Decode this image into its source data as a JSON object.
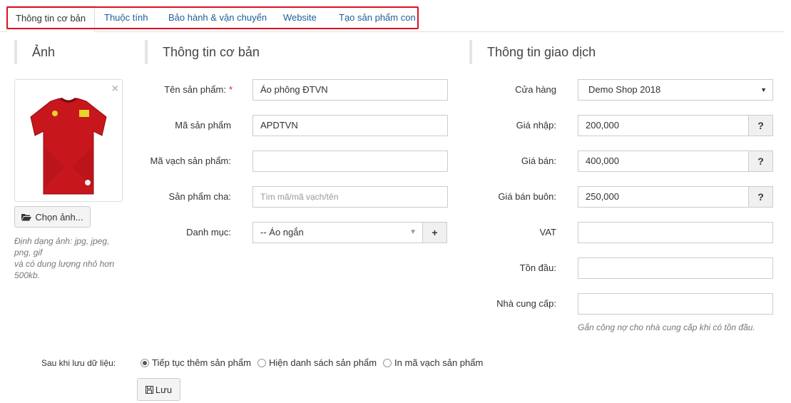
{
  "tabs": [
    {
      "label": "Thông tin cơ bản"
    },
    {
      "label": "Thuộc tính"
    },
    {
      "label": "Bảo hành & vận chuyển"
    },
    {
      "label": "Website"
    },
    {
      "label": "Tạo sản phẩm con"
    }
  ],
  "image_panel": {
    "title": "Ảnh",
    "choose_button": "Chọn ảnh...",
    "hint_line1": "Định dạng ảnh: jpg, jpeg,",
    "hint_line2": "png, gif",
    "hint_line3": "và có dung lượng nhỏ hơn",
    "hint_line4": "500kb."
  },
  "basic_info": {
    "title": "Thông tin cơ bản",
    "product_name_label": "Tên sản phẩm:",
    "product_name_value": "Áo phông ĐTVN",
    "product_code_label": "Mã sản phẩm",
    "product_code_value": "APDTVN",
    "barcode_label": "Mã vạch sản phẩm:",
    "barcode_value": "",
    "parent_label": "Sản phẩm cha:",
    "parent_placeholder": "Tìm mã/mã vạch/tên",
    "category_label": "Danh mục:",
    "category_value": "-- Áo ngắn"
  },
  "transaction_info": {
    "title": "Thông tin giao dịch",
    "store_label": "Cửa hàng",
    "store_value": "Demo Shop 2018",
    "cost_label": "Giá nhập:",
    "cost_value": "200,000",
    "price_label": "Giá bán:",
    "price_value": "400,000",
    "wholesale_label": "Giá bán buôn:",
    "wholesale_value": "250,000",
    "vat_label": "VAT",
    "vat_value": "",
    "opening_stock_label": "Tồn đầu:",
    "opening_stock_value": "",
    "supplier_label": "Nhà cung cấp:",
    "supplier_value": "",
    "supplier_hint": "Gắn công nợ cho nhà cung cấp khi có tồn đầu.",
    "help_symbol": "?",
    "add_symbol": "+"
  },
  "after_save": {
    "label": "Sau khi lưu dữ liệu:",
    "options": [
      {
        "label": "Tiếp tục thêm sản phẩm",
        "checked": true
      },
      {
        "label": "Hiện danh sách sản phẩm",
        "checked": false
      },
      {
        "label": "In mã vạch sản phẩm",
        "checked": false
      }
    ],
    "save_button": "Lưu"
  },
  "colors": {
    "tab_link": "#1f5e96",
    "highlight_border": "#e01020",
    "required_star": "#dd2222",
    "shirt_red": "#c8161d"
  }
}
